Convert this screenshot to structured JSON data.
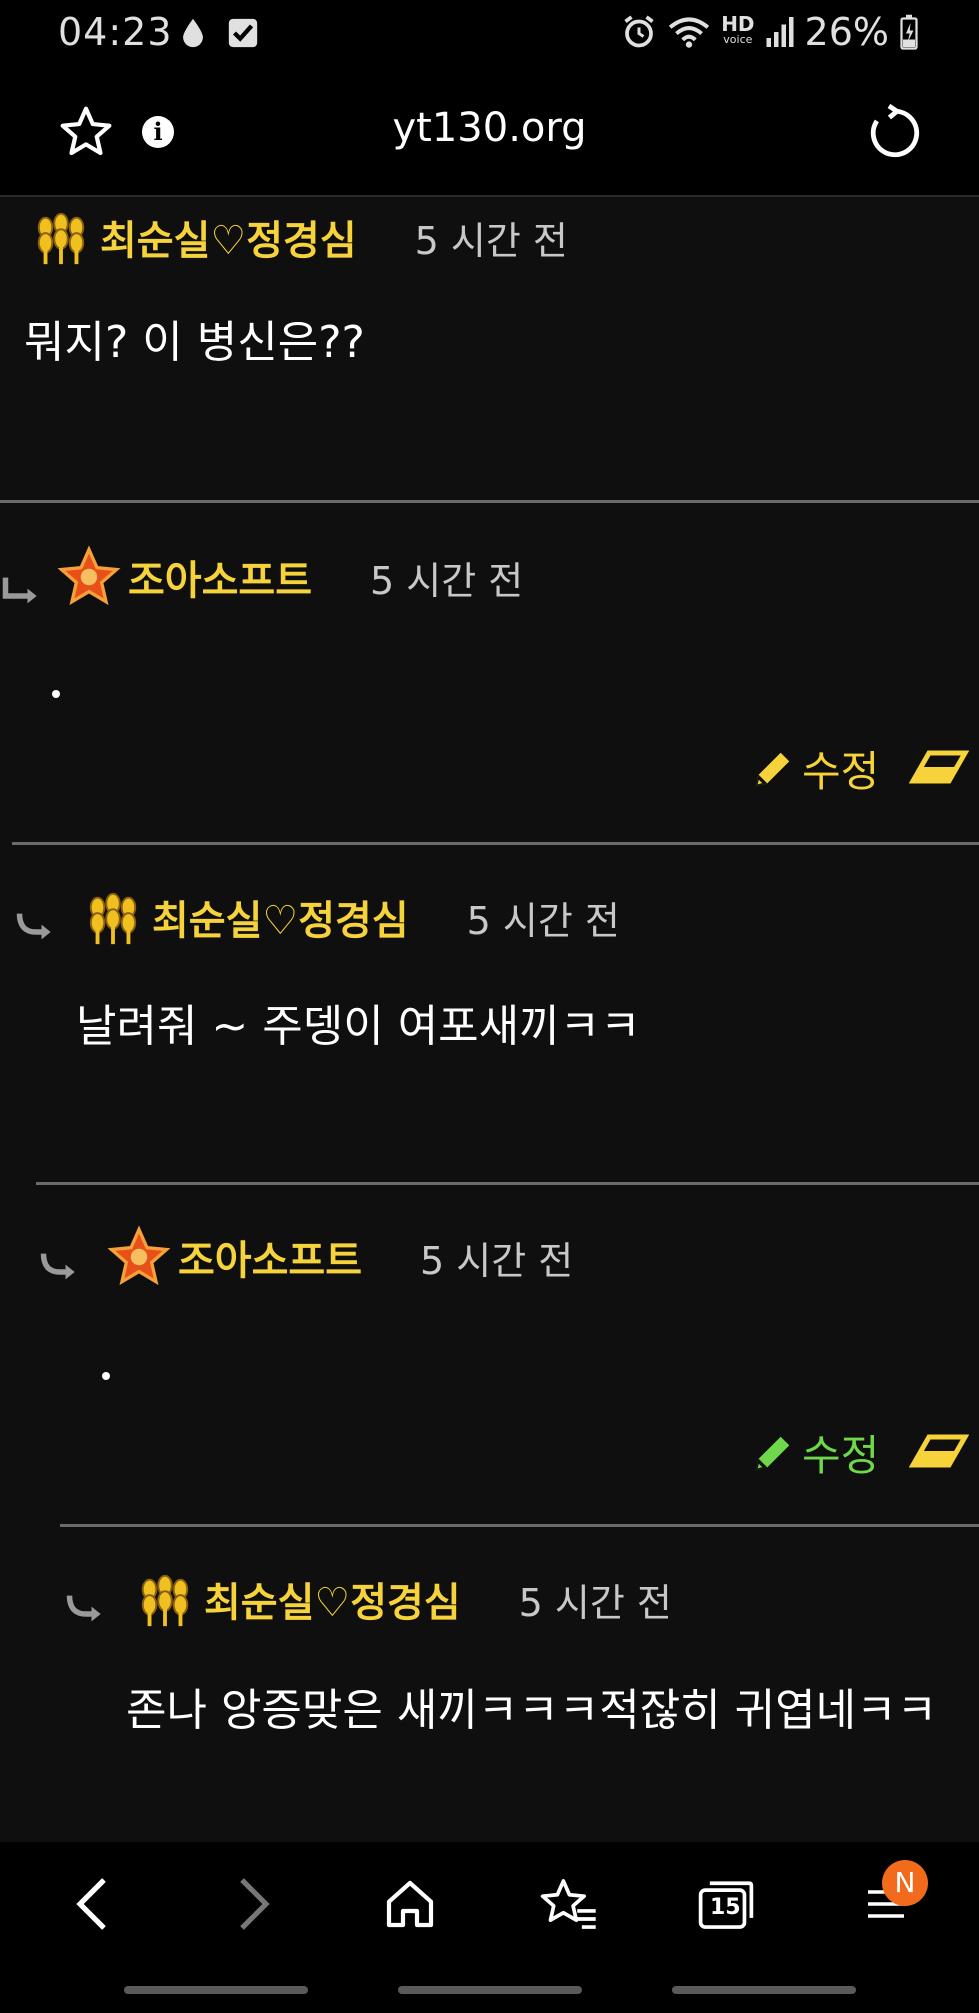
{
  "status_bar": {
    "time": "04:23",
    "battery": "26%",
    "icons": [
      "drop-icon",
      "checkbox-icon",
      "alarm-icon",
      "wifi-icon",
      "hd-voice-icon",
      "signal-icon",
      "battery-charging-icon"
    ],
    "hd_label": "HD",
    "voice_label": "voice"
  },
  "browser": {
    "url": "yt130.org",
    "info_glyph": "i",
    "tabs_count": "15",
    "menu_badge": "N"
  },
  "comments": [
    {
      "user": "최순실♡정경심",
      "time": "5 시간 전",
      "body": "뭐지? 이 병신은??",
      "badge": "wheat-badge-icon"
    },
    {
      "user": "조아소프트",
      "time": "5 시간 전",
      "body": "",
      "badge": "star-badge-icon",
      "edit_label": "수정"
    },
    {
      "user": "최순실♡정경심",
      "time": "5 시간 전",
      "body": "날려줘 ~ 주뎅이 여포새끼ㅋㅋ",
      "badge": "wheat-badge-icon"
    },
    {
      "user": "조아소프트",
      "time": "5 시간 전",
      "body": "",
      "badge": "star-badge-icon",
      "edit_label": "수정"
    },
    {
      "user": "최순실♡정경심",
      "time": "5 시간 전",
      "body": "존나 앙증맞은 새끼ㅋㅋㅋ적잖히 귀엽네ㅋㅋ",
      "badge": "wheat-badge-icon"
    }
  ],
  "colors": {
    "username": "#f6d33a",
    "edit_yellow": "#f6d33a",
    "edit_green": "#6ed84a",
    "badge_orange": "#f26a1b"
  }
}
